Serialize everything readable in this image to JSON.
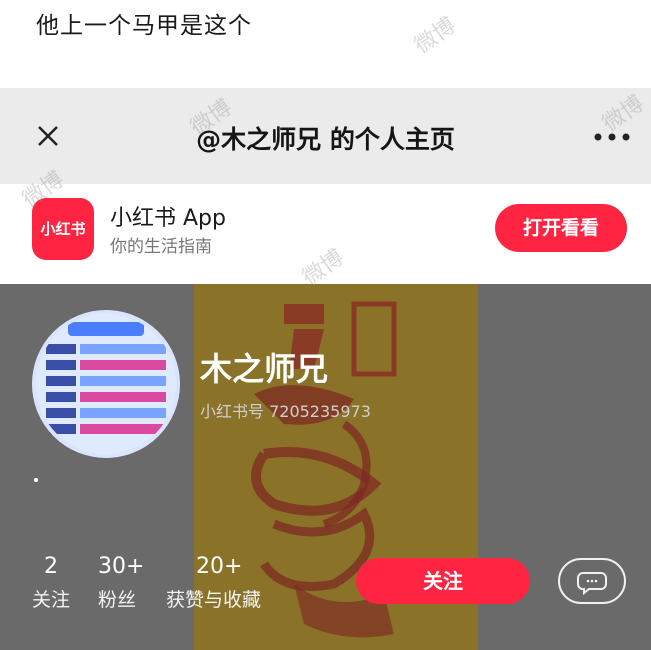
{
  "caption": "他上一个马甲是这个",
  "topbar": {
    "title": "@木之师兄 的个人主页",
    "close_icon": "close-icon",
    "more_icon": "more-icon"
  },
  "app_banner": {
    "logo_text": "小红书",
    "name": "小红书 App",
    "slogan": "你的生活指南",
    "open_button": "打开看看",
    "accent": "#ff2442"
  },
  "profile": {
    "name": "木之师兄",
    "id_label": "小红书号 7205235973",
    "bio": ".",
    "stats": [
      {
        "value": "2",
        "label": "关注"
      },
      {
        "value": "30+",
        "label": "粉丝"
      },
      {
        "value": "20+",
        "label": "获赞与收藏"
      }
    ],
    "follow_button": "关注",
    "chat_icon": "chat-icon"
  },
  "watermarks": [
    "微博",
    "微博",
    "微博",
    "微博",
    "微博"
  ]
}
